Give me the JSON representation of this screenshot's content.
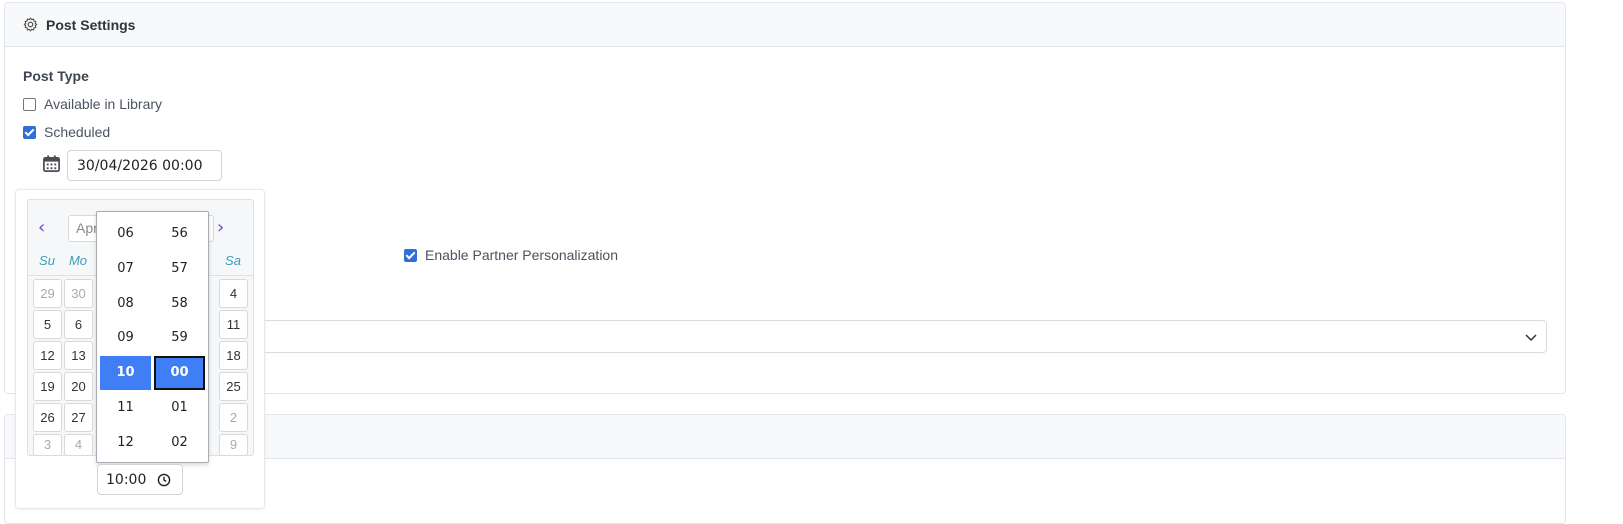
{
  "card": {
    "title": "Post Settings",
    "icon": "gear-icon"
  },
  "post_type": {
    "label": "Post Type",
    "options": [
      {
        "label": "Available in Library",
        "checked": false
      },
      {
        "label": "Scheduled",
        "checked": true
      }
    ]
  },
  "schedule": {
    "date_value": "30/04/2026 00:00"
  },
  "partner": {
    "label": "Enable Partner Personalization",
    "checked": true
  },
  "picker": {
    "month": "April",
    "month_visible": "Apr",
    "weekday_labels": [
      "Su",
      "Mo",
      "Sa"
    ],
    "rows": [
      [
        "29",
        "30",
        "4"
      ],
      [
        "5",
        "6",
        "11"
      ],
      [
        "12",
        "13",
        "18"
      ],
      [
        "19",
        "20",
        "25"
      ],
      [
        "26",
        "27",
        "2"
      ],
      [
        "3",
        "4",
        "9"
      ]
    ],
    "hours": [
      "06",
      "07",
      "08",
      "09",
      "10",
      "11",
      "12"
    ],
    "minutes": [
      "56",
      "57",
      "58",
      "59",
      "00",
      "01",
      "02"
    ],
    "selected_hour": "10",
    "selected_minute": "00",
    "time_value": "10:00"
  },
  "colors": {
    "accent": "#3f7ef5",
    "checkbox": "#2f6fd6",
    "nav_arrow": "#6c3fd6",
    "weekday": "#3aa0b8"
  }
}
